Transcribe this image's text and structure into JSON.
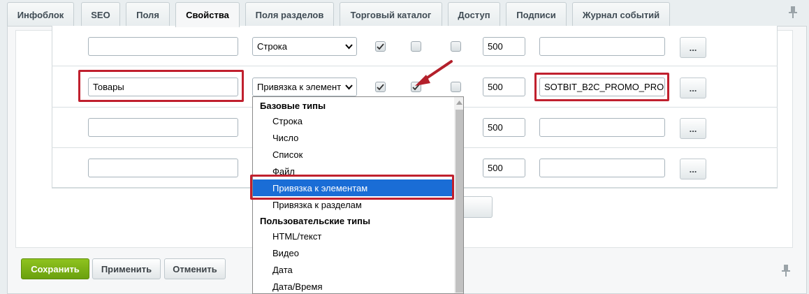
{
  "tabs": [
    "Инфоблок",
    "SEO",
    "Поля",
    "Свойства",
    "Поля разделов",
    "Торговый каталог",
    "Доступ",
    "Подписи",
    "Журнал событий"
  ],
  "active_tab": "Свойства",
  "rows": [
    {
      "name": "",
      "type": "Строка",
      "checks": [
        true,
        false,
        false
      ],
      "sort": "500",
      "code": ""
    },
    {
      "name": "Товары",
      "type": "Привязка к элемент",
      "checks": [
        true,
        true,
        false
      ],
      "sort": "500",
      "code": "SOTBIT_B2C_PROMO_PRO"
    },
    {
      "name": "",
      "type": "",
      "checks": [],
      "sort": "500",
      "code": ""
    },
    {
      "name": "",
      "type": "",
      "checks": [],
      "sort": "500",
      "code": ""
    }
  ],
  "more_button_label": "...",
  "dropdown": {
    "items": [
      {
        "label": "Базовые типы",
        "group": true
      },
      {
        "label": "Строка"
      },
      {
        "label": "Число"
      },
      {
        "label": "Список"
      },
      {
        "label": "Файл"
      },
      {
        "label": "Привязка к элементам",
        "selected": true
      },
      {
        "label": "Привязка к разделам"
      },
      {
        "label": "Пользовательские типы",
        "group": true
      },
      {
        "label": "HTML/текст"
      },
      {
        "label": "Видео"
      },
      {
        "label": "Дата"
      },
      {
        "label": "Дата/Время"
      }
    ]
  },
  "footer": {
    "save": "Сохранить",
    "apply": "Применить",
    "cancel": "Отменить"
  },
  "colors": {
    "highlight": "#c0202e",
    "selected": "#1a6dd6",
    "save_button": "#7cb516"
  },
  "icons": {
    "pin": "pin-icon",
    "chevron": "chevron-down-icon",
    "check": "check-icon",
    "arrow": "annotation-arrow-icon"
  }
}
